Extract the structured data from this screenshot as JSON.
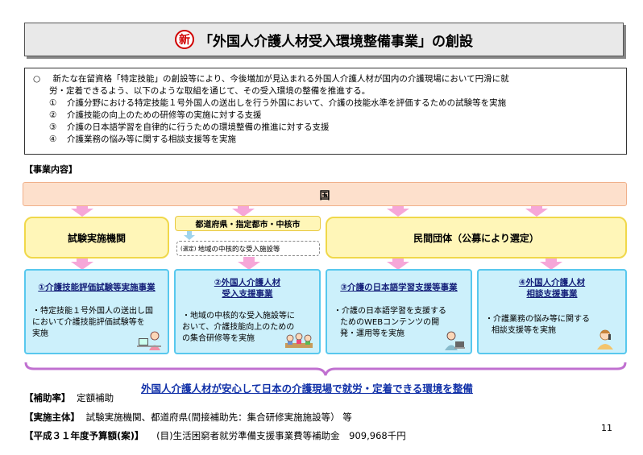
{
  "title": {
    "badge": "新",
    "text": "「外国人介護人材受入環境整備事業」の創設"
  },
  "intro": {
    "bullet": "○",
    "line1": "新たな在留資格「特定技能」の創設等により、今後増加が見込まれる外国人介護人材が国内の介護現場において円滑に就",
    "line2": "労・定着できるよう、以下のような取組を通じて、その受入環境の整備を推進する。",
    "items": [
      {
        "num": "①",
        "text": "介護分野における特定技能１号外国人の送出しを行う外国において、介護の技能水準を評価するための試験等を実施"
      },
      {
        "num": "②",
        "text": "介護技能の向上のための研修等の実施に対する支援"
      },
      {
        "num": "③",
        "text": "介護の日本語学習を自律的に行うための環境整備の推進に対する支援"
      },
      {
        "num": "④",
        "text": "介護業務の悩み等に関する相談支援等を実施"
      }
    ]
  },
  "section_label": "【事業内容】",
  "kuni": "国",
  "test_org": "試験実施機関",
  "pref": "都道府県・指定都市・中核市",
  "facility_prefix": "(選定)",
  "facility": "地域の中核的な受入施設等",
  "private_org": "民間団体（公募により選定）",
  "boxes": [
    {
      "title1": "①介護技能評価試験等実施事業",
      "title2": "",
      "body": [
        "・特定技能１号外国人の送出し国",
        "において介護技能評価試験等を",
        "実施"
      ]
    },
    {
      "title1": "②外国人介護人材",
      "title2": "受入支援事業",
      "body": [
        "・地域の中核的な受入施設等に",
        "おいて、介護技能向上のための",
        "の集合研修等を実施"
      ]
    },
    {
      "title1": "③介護の日本語学習支援等事業",
      "title2": "",
      "body": [
        "・介護の日本語学習を支援する",
        "ためのWEBコンテンツの開",
        "発・運用等を実施"
      ]
    },
    {
      "title1": "④外国人介護人材",
      "title2": "相談支援事業",
      "body": [
        "・介護業務の悩み等に関する",
        "相談支援等を実施"
      ]
    }
  ],
  "outcome": "外国人介護人材が安心して日本の介護現場で就労・定着できる環境を整備",
  "footer": {
    "rate_label": "【補助率】",
    "rate_value": "定額補助",
    "actor_label": "【実施主体】",
    "actor_value": "試験実施機関、都道府県(間接補助先：集合研修実施施設等） 等",
    "budget_label": "【平成３１年度予算額(案)】",
    "budget_value": "(目)生活困窮者就労準備支援事業費等補助金　909,968千円"
  },
  "page_number": "11",
  "colors": {
    "kuni_fill": "#fde0cc",
    "yellow_fill": "#fff6b8",
    "blue_fill": "#ccf0fb",
    "arrow_pink": "#f6a7d8",
    "outcome_text": "#1030a8",
    "badge_red": "#d00000"
  }
}
